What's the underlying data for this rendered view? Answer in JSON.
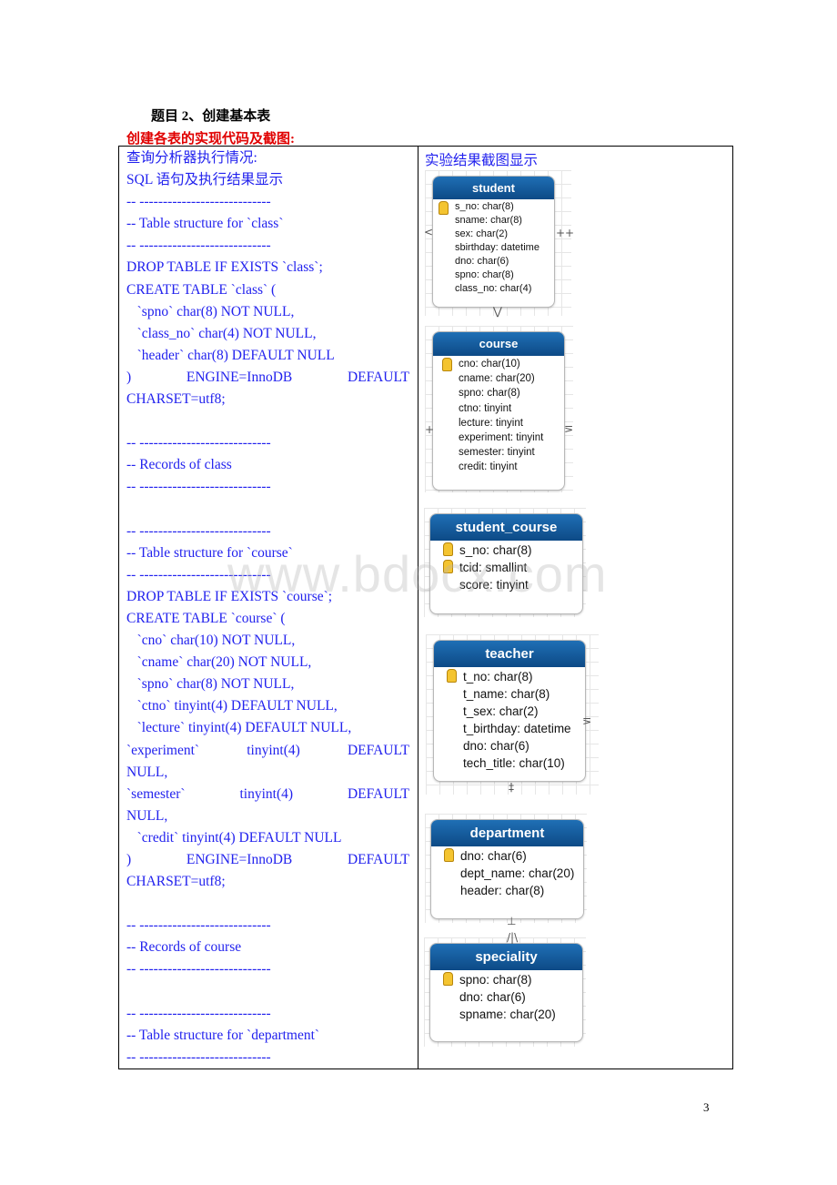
{
  "heading": "题目 2、创建基本表",
  "subheading": "创建各表的实现代码及截图:",
  "left_column": {
    "lines": [
      {
        "text": "查询分析器执行情况:"
      },
      {
        "text": "SQL 语句及执行结果显示"
      },
      {
        "text": "-- ----------------------------"
      },
      {
        "text": "-- Table structure for `class`"
      },
      {
        "text": "-- ----------------------------"
      },
      {
        "text": "DROP TABLE IF EXISTS `class`;"
      },
      {
        "text": "CREATE TABLE `class` ("
      },
      {
        "text": "   `spno` char(8) NOT NULL,"
      },
      {
        "text": "   `class_no` char(4) NOT NULL,"
      },
      {
        "text": "   `header` char(8) DEFAULT NULL"
      },
      {
        "text": ") ENGINE=InnoDB DEFAULT",
        "justify": true
      },
      {
        "text": "CHARSET=utf8;"
      },
      {
        "text": ""
      },
      {
        "text": "-- ----------------------------"
      },
      {
        "text": "-- Records of class"
      },
      {
        "text": "-- ----------------------------"
      },
      {
        "text": ""
      },
      {
        "text": "-- ----------------------------"
      },
      {
        "text": "-- Table structure for `course`"
      },
      {
        "text": "-- ----------------------------"
      },
      {
        "text": "DROP TABLE IF EXISTS `course`;"
      },
      {
        "text": "CREATE TABLE `course` ("
      },
      {
        "text": "   `cno` char(10) NOT NULL,"
      },
      {
        "text": "   `cname` char(20) NOT NULL,"
      },
      {
        "text": "   `spno` char(8) NOT NULL,"
      },
      {
        "text": "   `ctno` tinyint(4) DEFAULT NULL,"
      },
      {
        "text": "   `lecture` tinyint(4) DEFAULT NULL,"
      },
      {
        "text": "   `experiment` tinyint(4) DEFAULT",
        "justify": true
      },
      {
        "text": "NULL,"
      },
      {
        "text": "   `semester` tinyint(4) DEFAULT",
        "justify": true
      },
      {
        "text": "NULL,"
      },
      {
        "text": "   `credit` tinyint(4) DEFAULT NULL"
      },
      {
        "text": ") ENGINE=InnoDB DEFAULT",
        "justify": true
      },
      {
        "text": "CHARSET=utf8;"
      },
      {
        "text": ""
      },
      {
        "text": "-- ----------------------------"
      },
      {
        "text": "-- Records of course"
      },
      {
        "text": "-- ----------------------------"
      },
      {
        "text": ""
      },
      {
        "text": "-- ----------------------------"
      },
      {
        "text": "-- Table structure for `department`"
      },
      {
        "text": "-- ----------------------------"
      }
    ]
  },
  "right_column": {
    "heading": "实验结果截图显示",
    "header_color": "#0d4a86",
    "entities": [
      {
        "name": "student",
        "fields": [
          "s_no: char(8)",
          "sname: char(8)",
          "sex: char(2)",
          "sbirthday: datetime",
          "dno: char(6)",
          "spno: char(8)",
          "class_no: char(4)"
        ],
        "keys": 1
      },
      {
        "name": "course",
        "fields": [
          "cno: char(10)",
          "cname: char(20)",
          "spno: char(8)",
          "ctno: tinyint",
          "lecture: tinyint",
          "experiment: tinyint",
          "semester: tinyint",
          "credit: tinyint"
        ],
        "keys": 1
      },
      {
        "name": "student_course",
        "fields": [
          "s_no: char(8)",
          "tcid: smallint",
          "score: tinyint"
        ],
        "keys": 2
      },
      {
        "name": "teacher",
        "fields": [
          "t_no: char(8)",
          "t_name: char(8)",
          "t_sex: char(2)",
          "t_birthday: datetime",
          "dno: char(6)",
          "tech_title: char(10)"
        ],
        "keys": 1
      },
      {
        "name": "department",
        "fields": [
          "dno: char(6)",
          "dept_name: char(20)",
          "header: char(8)"
        ],
        "keys": 1
      },
      {
        "name": "speciality",
        "fields": [
          "spno: char(8)",
          "dno: char(6)",
          "spname: char(20)"
        ],
        "keys": 1
      }
    ]
  },
  "watermark": "www.bdocx.com",
  "page_number": "3"
}
